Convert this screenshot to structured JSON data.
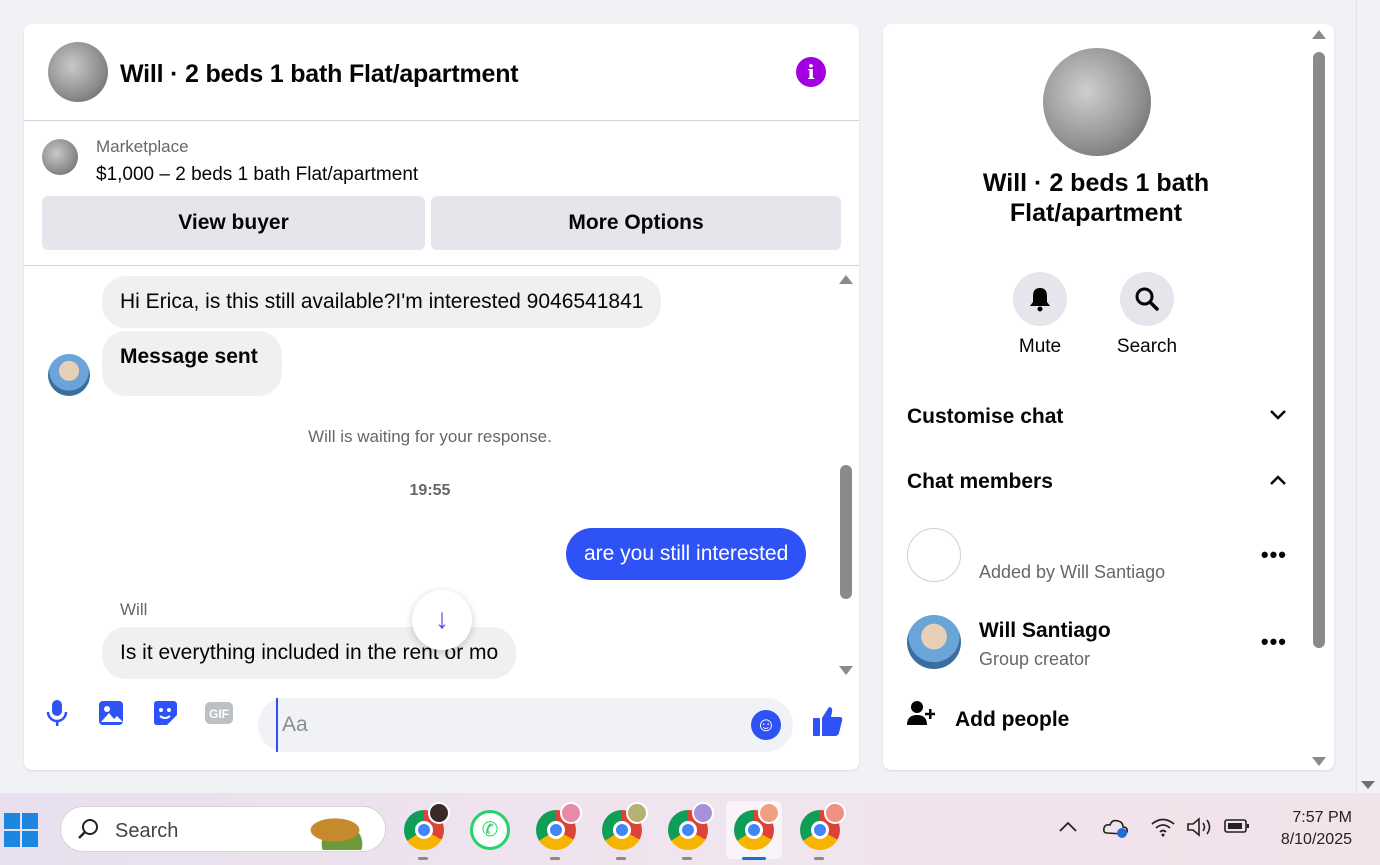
{
  "chat": {
    "title": "Will · 2 beds 1 bath Flat/apartment",
    "listing": {
      "label": "Marketplace",
      "title": "$1,000 – 2 beds 1 bath Flat/apartment"
    },
    "buttons": {
      "view_buyer": "View buyer",
      "more_options": "More Options"
    },
    "messages": {
      "m1": "Hi Erica, is this still available?I'm interested 9046541841",
      "m2": "Message sent",
      "status": "Will is waiting for your response.",
      "time": "19:55",
      "out": "are you still interested",
      "sender": "Will",
      "m3": "Is it everything included in the rent or mo"
    },
    "composer": {
      "placeholder": "Aa"
    }
  },
  "panel": {
    "title": "Will · 2 beds 1 bath Flat/apartment",
    "actions": {
      "mute": "Mute",
      "search": "Search"
    },
    "sections": {
      "customise": "Customise chat",
      "members": "Chat members"
    },
    "members": [
      {
        "name": "",
        "sub": "Added by Will Santiago"
      },
      {
        "name": "Will Santiago",
        "sub": "Group creator"
      }
    ],
    "add_people": "Add people"
  },
  "taskbar": {
    "search": "Search",
    "time": "7:57 PM",
    "date": "8/10/2025"
  },
  "colors": {
    "accent": "#2e52f5",
    "info": "#a200e0"
  }
}
